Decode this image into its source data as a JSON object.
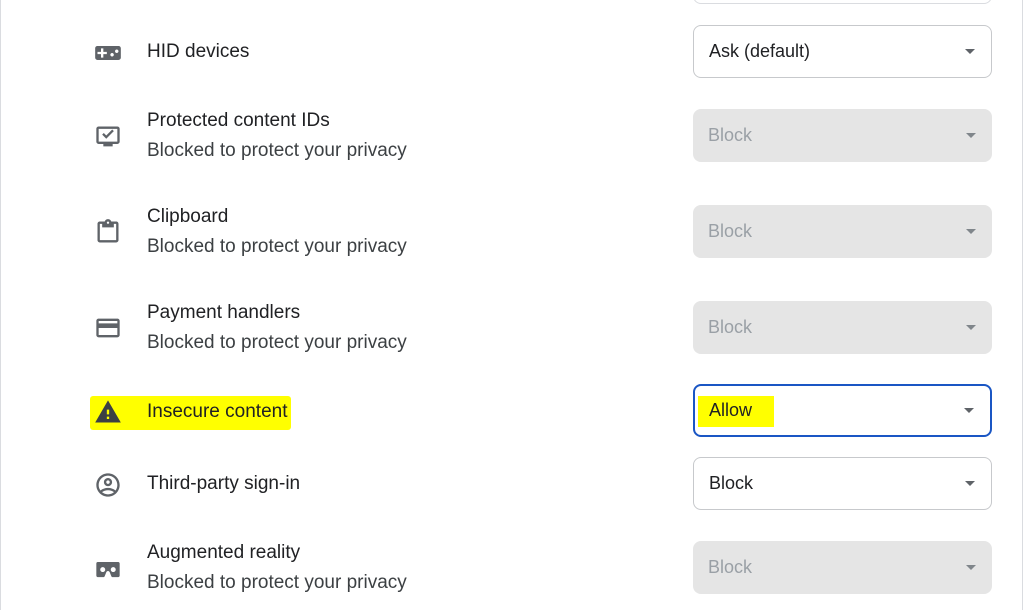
{
  "settings": [
    {
      "id": "hid",
      "icon": "gamepad-icon",
      "title": "HID devices",
      "subtitle": "",
      "value": "Ask (default)",
      "disabled": false
    },
    {
      "id": "protected",
      "icon": "monitor-check-icon",
      "title": "Protected content IDs",
      "subtitle": "Blocked to protect your privacy",
      "value": "Block",
      "disabled": true
    },
    {
      "id": "clipboard",
      "icon": "clipboard-icon",
      "title": "Clipboard",
      "subtitle": "Blocked to protect your privacy",
      "value": "Block",
      "disabled": true
    },
    {
      "id": "payment",
      "icon": "credit-card-icon",
      "title": "Payment handlers",
      "subtitle": "Blocked to protect your privacy",
      "value": "Block",
      "disabled": true
    },
    {
      "id": "insecure",
      "icon": "warning-icon",
      "title": "Insecure content",
      "subtitle": "",
      "value": "Allow",
      "disabled": false
    },
    {
      "id": "thirdparty",
      "icon": "account-circle-icon",
      "title": "Third-party sign-in",
      "subtitle": "",
      "value": "Block",
      "disabled": false
    },
    {
      "id": "ar",
      "icon": "vr-headset-icon",
      "title": "Augmented reality",
      "subtitle": "Blocked to protect your privacy",
      "value": "Block",
      "disabled": true
    }
  ],
  "highlight_color": "#ffff00",
  "focus_color": "#1a56c4"
}
